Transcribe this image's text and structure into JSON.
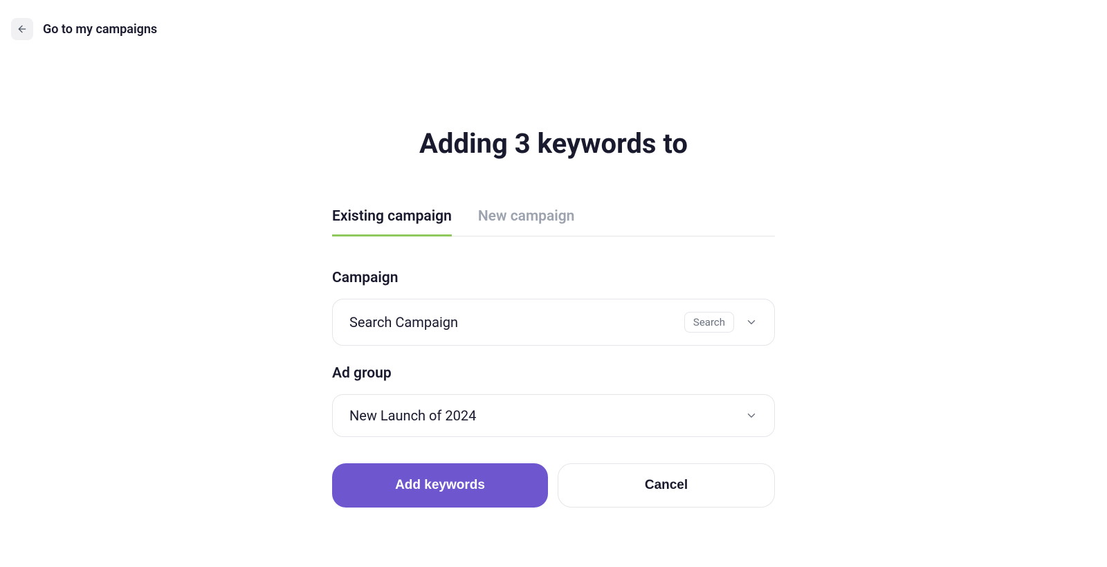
{
  "topbar": {
    "back_label": "Go to my campaigns"
  },
  "page": {
    "title": "Adding 3 keywords to"
  },
  "tabs": {
    "existing": "Existing campaign",
    "new": "New campaign"
  },
  "campaign": {
    "label": "Campaign",
    "value": "Search Campaign",
    "badge": "Search"
  },
  "adgroup": {
    "label": "Ad group",
    "value": "New Launch of 2024"
  },
  "buttons": {
    "primary": "Add keywords",
    "secondary": "Cancel"
  }
}
